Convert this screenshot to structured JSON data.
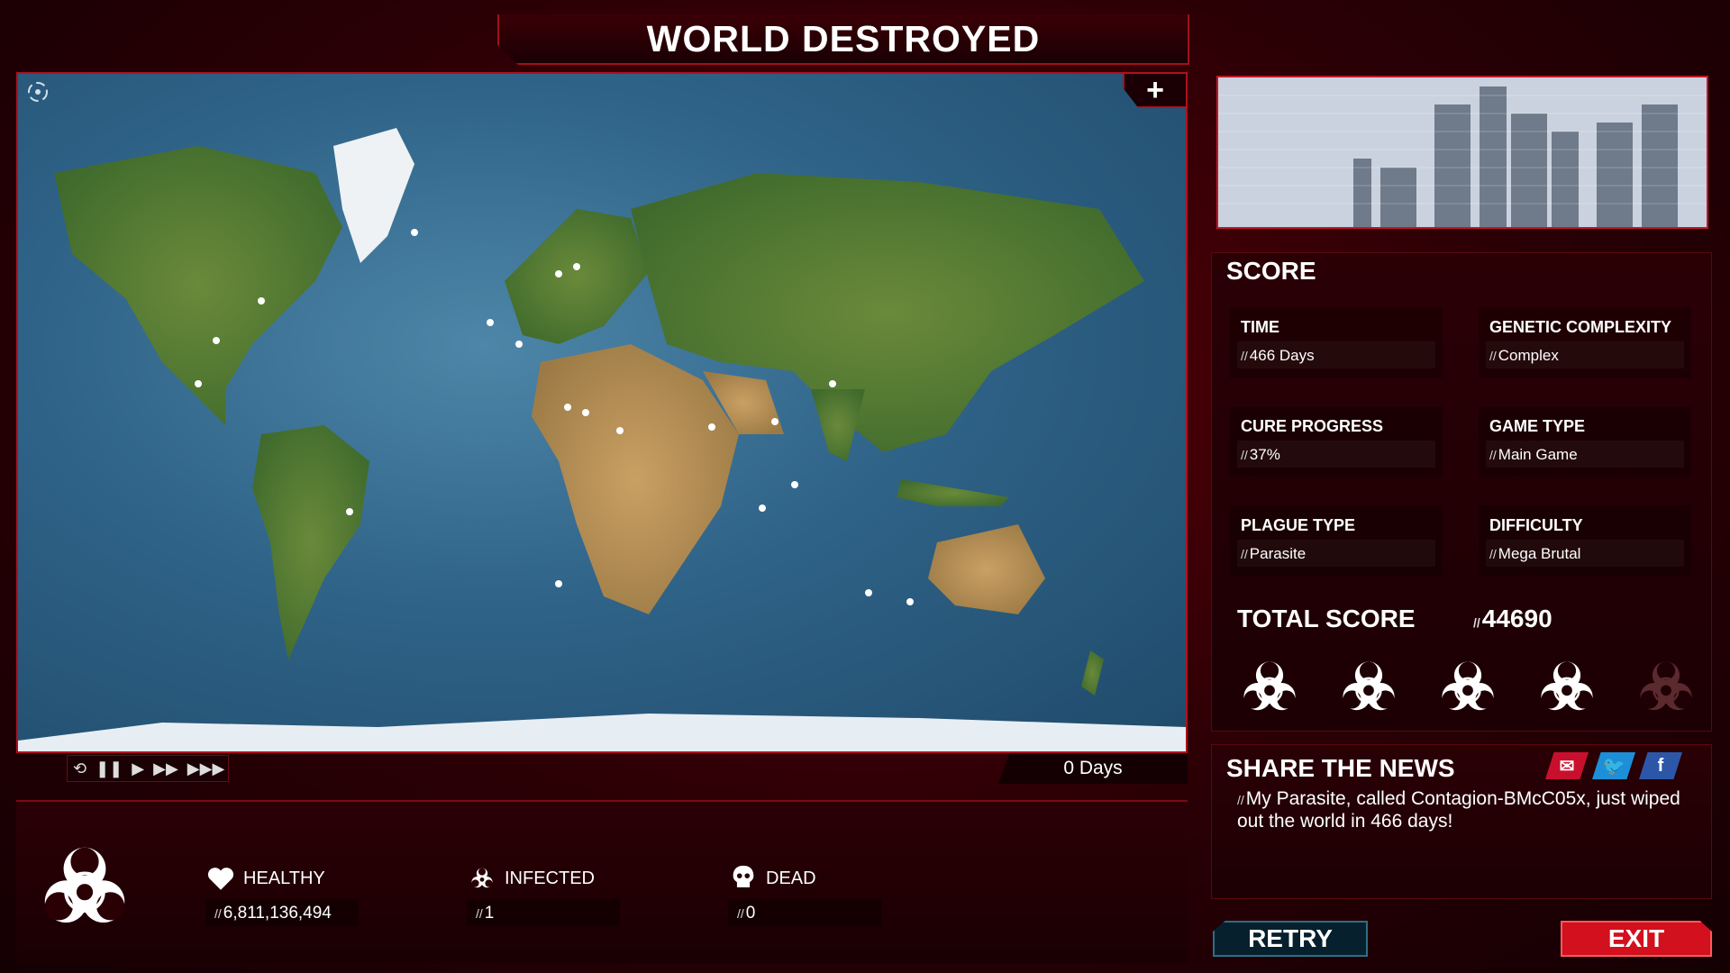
{
  "header": {
    "title": "WORLD DESTROYED"
  },
  "map": {
    "zoom_label": "+",
    "days_label": "0 Days"
  },
  "playback": {
    "restart_icon": "restart-icon",
    "pause_icon": "pause-icon",
    "play_icon": "play-icon",
    "ff_icon": "fast-forward-icon",
    "fff_icon": "fastest-forward-icon"
  },
  "stats": {
    "healthy": {
      "label": "HEALTHY",
      "value": "6,811,136,494",
      "icon": "heart-icon"
    },
    "infected": {
      "label": "INFECTED",
      "value": "1",
      "icon": "biohazard-icon"
    },
    "dead": {
      "label": "DEAD",
      "value": "0",
      "icon": "skull-icon"
    }
  },
  "score": {
    "title": "SCORE",
    "cells": [
      {
        "key": "TIME",
        "value": "466 Days"
      },
      {
        "key": "GENETIC COMPLEXITY",
        "value": "Complex"
      },
      {
        "key": "CURE PROGRESS",
        "value": "37%"
      },
      {
        "key": "GAME TYPE",
        "value": "Main Game"
      },
      {
        "key": "PLAGUE TYPE",
        "value": "Parasite"
      },
      {
        "key": "DIFFICULTY",
        "value": "Mega Brutal"
      }
    ],
    "total_label": "TOTAL SCORE",
    "total_value": "44690",
    "rating_filled": 4,
    "rating_max": 5
  },
  "share": {
    "title": "SHARE THE NEWS",
    "text": "My Parasite, called Contagion-BMcC05x, just wiped out the world in 466 days!",
    "mail_icon": "mail-icon",
    "twitter_icon": "twitter-icon",
    "facebook_label": "f"
  },
  "buttons": {
    "retry": "RETRY",
    "exit": "EXIT"
  },
  "colors": {
    "accent": "#c01828",
    "panel": "#2a0005",
    "retry": "#06202e",
    "exit": "#d3101d"
  }
}
